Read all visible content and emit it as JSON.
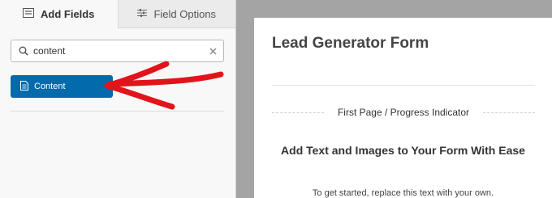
{
  "tabs": [
    {
      "label": "Add Fields",
      "icon": "list-icon",
      "active": true
    },
    {
      "label": "Field Options",
      "icon": "sliders-icon",
      "active": false
    }
  ],
  "search": {
    "value": "content",
    "placeholder": "Search fields..."
  },
  "field_button": {
    "label": "Content",
    "icon": "document-icon"
  },
  "form": {
    "title": "Lead Generator Form",
    "page_break_label": "First Page / Progress Indicator",
    "content_heading": "Add Text and Images to Your Form With Ease",
    "content_text": "To get started, replace this text with your own."
  },
  "colors": {
    "accent": "#036aab",
    "arrow": "#e2141b",
    "panel_bg": "#f8f8f8",
    "gap_bg": "#a4a4a4"
  }
}
